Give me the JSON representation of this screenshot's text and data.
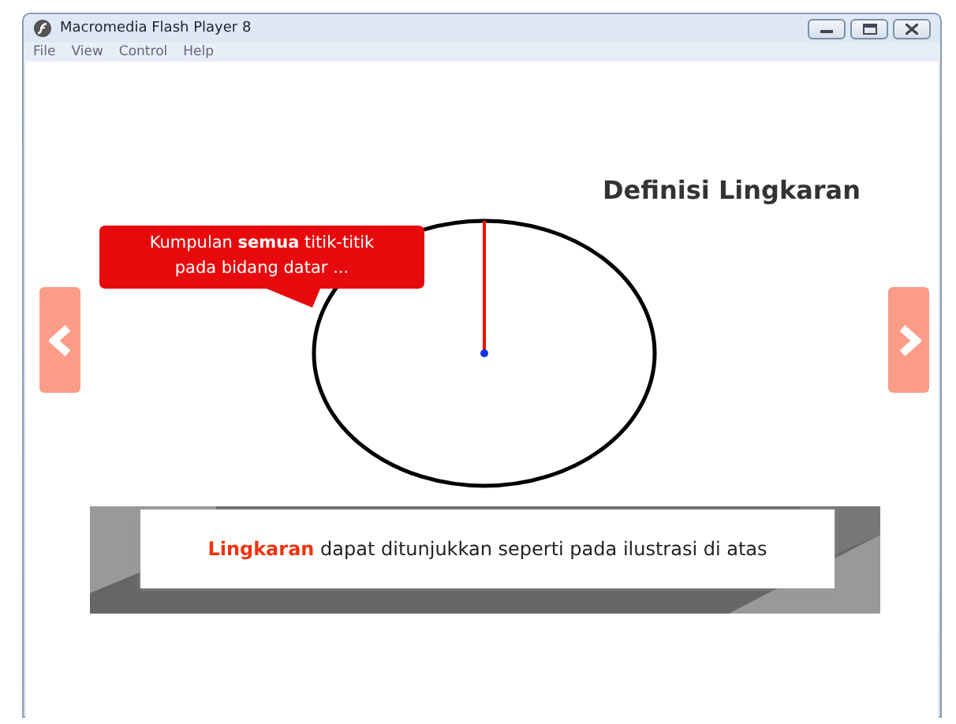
{
  "window": {
    "title": "Macromedia Flash Player 8"
  },
  "menu": [
    "File",
    "View",
    "Control",
    "Help"
  ],
  "slide": {
    "title": "Definisi Lingkaran",
    "callout": "Kumpulan **semua** titik-titik pada bidang datar ...",
    "caption": "**Lingkaran** dapat ditunjukkan seperti pada ilustrasi di atas"
  }
}
